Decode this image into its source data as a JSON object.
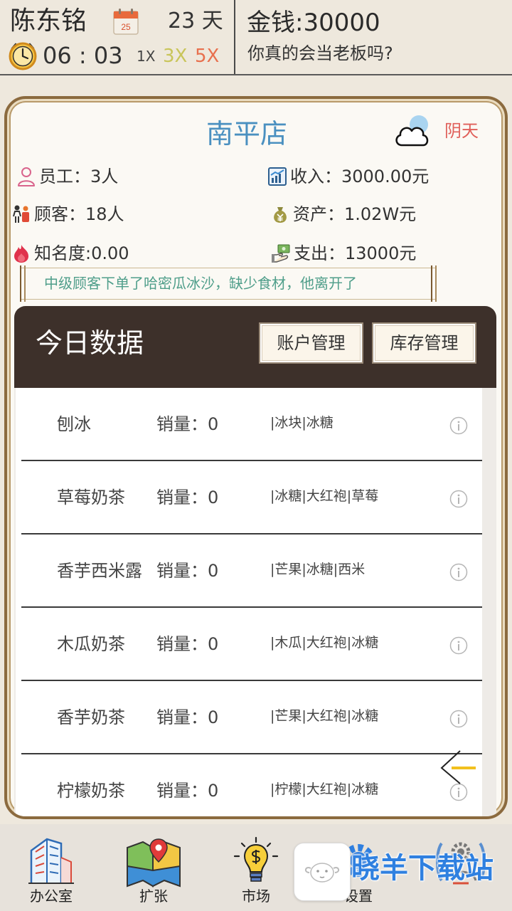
{
  "player": {
    "name": "陈东铭"
  },
  "calendar": {
    "icon": "calendar-icon",
    "date_number": "25",
    "days": "23 天"
  },
  "clock": {
    "icon": "clock-icon",
    "time": "06 : 03"
  },
  "speed_options": [
    {
      "label": "1X",
      "color": "#444444"
    },
    {
      "label": "3X",
      "color": "#c9c55a"
    },
    {
      "label": "5X",
      "color": "#e8704e"
    }
  ],
  "money": "金钱:30000",
  "slogan": "你真的会当老板吗?",
  "store": {
    "name": "南平店",
    "weather": {
      "icon": "cloudy-icon",
      "label": "阴天"
    },
    "stats": [
      {
        "icon": "employee-icon",
        "label": "员工：",
        "value": "3人"
      },
      {
        "icon": "income-chart-icon",
        "label": "收入：",
        "value": "3000.00元"
      },
      {
        "icon": "customers-icon",
        "label": "顾客：",
        "value": "18人"
      },
      {
        "icon": "money-bag-icon",
        "label": "资产：",
        "value": "1.02W元"
      },
      {
        "icon": "fame-flame-icon",
        "label": "知名度:",
        "value": "0.00"
      },
      {
        "icon": "expense-hand-icon",
        "label": "支出：",
        "value": "13000元"
      }
    ],
    "message": "中级顾客下单了哈密瓜冰沙，缺少食材，他离开了"
  },
  "today": {
    "title": "今日数据",
    "buttons": {
      "accounts": "账户管理",
      "inventory": "库存管理"
    },
    "sales_label": "销量：",
    "products": [
      {
        "name": "刨冰",
        "sales": "0",
        "ingredients": "|冰块|冰糖"
      },
      {
        "name": "草莓奶茶",
        "sales": "0",
        "ingredients": "|冰糖|大红袍|草莓"
      },
      {
        "name": "香芋西米露",
        "sales": "0",
        "ingredients": "|芒果|冰糖|西米"
      },
      {
        "name": "木瓜奶茶",
        "sales": "0",
        "ingredients": "|木瓜|大红袍|冰糖"
      },
      {
        "name": "香芋奶茶",
        "sales": "0",
        "ingredients": "|芒果|大红袍|冰糖"
      },
      {
        "name": "柠檬奶茶",
        "sales": "0",
        "ingredients": "|柠檬|大红袍|冰糖"
      }
    ],
    "row_icon": "info-icon",
    "collapse_icon": "back-arrow-icon"
  },
  "nav": [
    {
      "label": "办公室",
      "icon": "office-building-icon"
    },
    {
      "label": "扩张",
      "icon": "map-pin-icon"
    },
    {
      "label": "市场",
      "icon": "lightbulb-icon"
    },
    {
      "label": "设置",
      "icon": "settings-icon"
    },
    {
      "icon": "gear-icon"
    }
  ],
  "watermark": {
    "text": "晓羊下载站",
    "icon": "sheep-icon"
  },
  "colors": {
    "background": "#eee8dd",
    "panel_border": "#8b6a3e",
    "store_name": "#4a90c0",
    "weather_label": "#e0605a",
    "message_text": "#4f9e8a",
    "section_header": "#3d302a",
    "watermark_text": "#2f80e0"
  }
}
